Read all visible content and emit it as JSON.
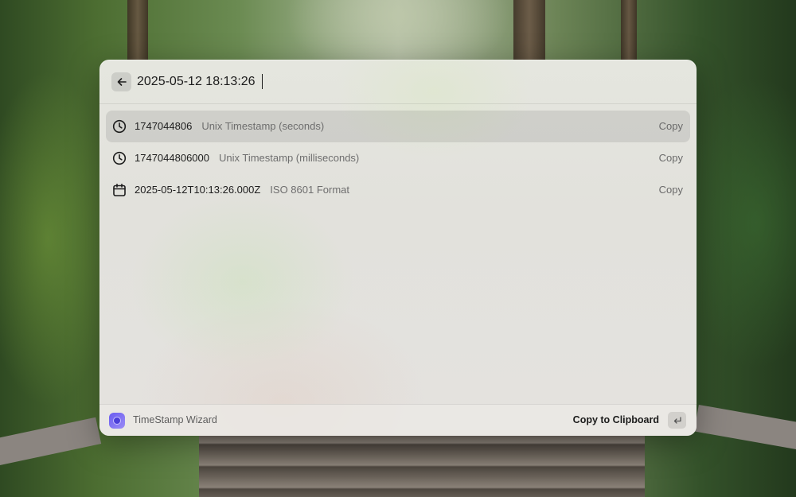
{
  "search": {
    "query": "2025-05-12 18:13:26"
  },
  "results": [
    {
      "icon": "clock-icon",
      "title": "1747044806",
      "subtitle": "Unix Timestamp (seconds)",
      "action": "Copy"
    },
    {
      "icon": "clock-icon",
      "title": "1747044806000",
      "subtitle": "Unix Timestamp (milliseconds)",
      "action": "Copy"
    },
    {
      "icon": "calendar-icon",
      "title": "2025-05-12T10:13:26.000Z",
      "subtitle": "ISO 8601 Format",
      "action": "Copy"
    }
  ],
  "footer": {
    "app_name": "TimeStamp Wizard",
    "primary_action": "Copy to Clipboard",
    "shortcut_icon": "enter-key-icon"
  },
  "colors": {
    "app_icon": "#6a5cf0",
    "selected_row": "rgba(0,0,0,0.09)"
  }
}
